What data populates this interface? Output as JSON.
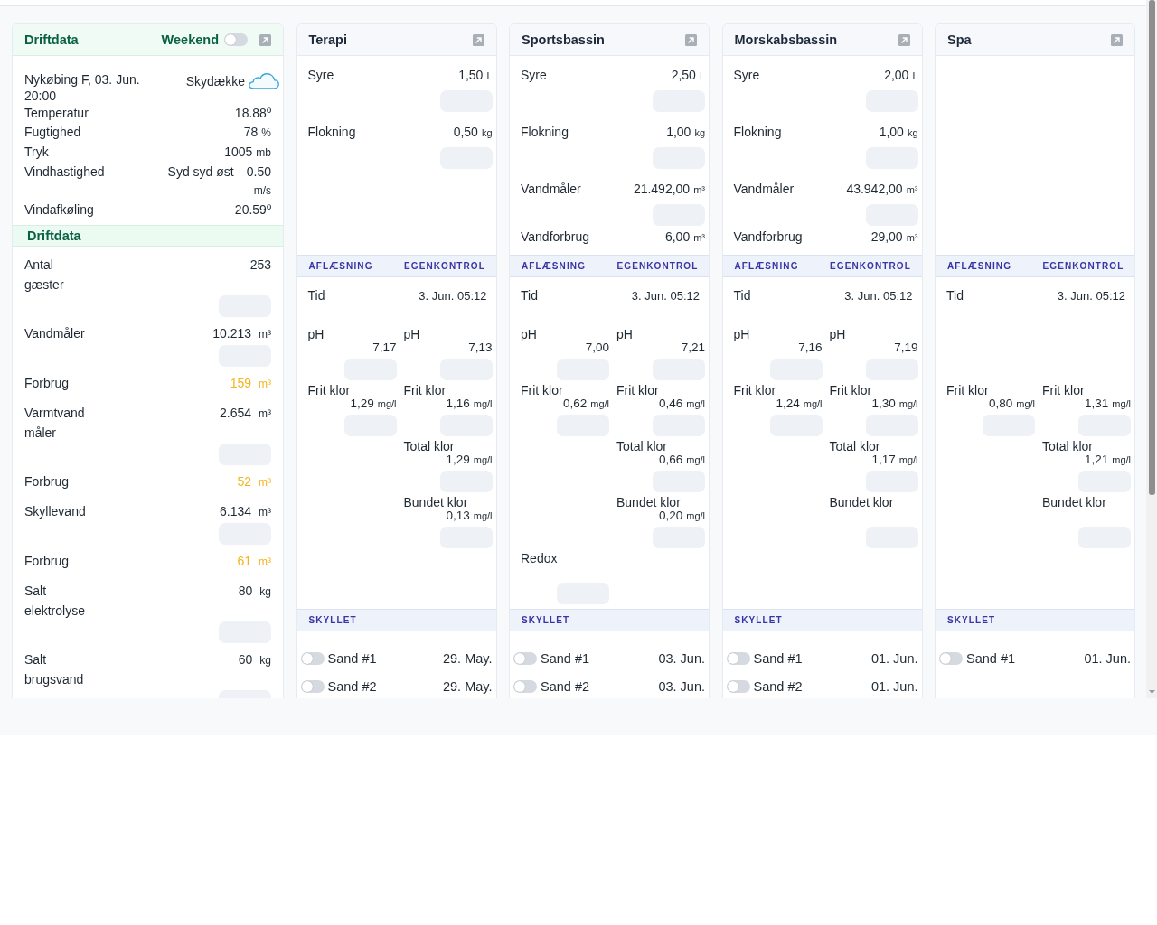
{
  "overview": {
    "title": "Driftdata",
    "weekend": {
      "label": "Weekend",
      "on": false
    },
    "weather": {
      "location": "Nykøbing F, 03. Jun. 20:00",
      "condition": "Skydække",
      "rows": [
        {
          "label": "Temperatur",
          "value": "18.88º"
        },
        {
          "label": "Fugtighed",
          "value": "78",
          "unit": "%"
        },
        {
          "label": "Tryk",
          "value": "1005",
          "unit": "mb"
        },
        {
          "label": "Vindhastighed",
          "direction": "Syd syd øst",
          "value": "0.50",
          "unit": "m/s"
        },
        {
          "label": "Vindafkøling",
          "value": "20.59º"
        }
      ]
    },
    "section_title": "Driftdata",
    "rows": [
      {
        "kind": "meter",
        "label": "Antal gæster",
        "value": "253"
      },
      {
        "kind": "meter",
        "label": "Vandmåler",
        "value": "10.213",
        "unit": "m³"
      },
      {
        "kind": "consumption",
        "label": "Forbrug",
        "value": "159",
        "unit": "m³"
      },
      {
        "kind": "meter",
        "label": "Varmtvand måler",
        "value": "2.654",
        "unit": "m³"
      },
      {
        "kind": "consumption",
        "label": "Forbrug",
        "value": "52",
        "unit": "m³"
      },
      {
        "kind": "meter",
        "label": "Skyllevand",
        "value": "6.134",
        "unit": "m³"
      },
      {
        "kind": "consumption",
        "label": "Forbrug",
        "value": "61",
        "unit": "m³"
      },
      {
        "kind": "meter",
        "label": "Salt elektrolyse",
        "value": "80",
        "unit": "kg"
      },
      {
        "kind": "meter",
        "label": "Salt brugsvand",
        "value": "60",
        "unit": "kg"
      }
    ]
  },
  "pools": [
    {
      "title": "Terapi",
      "supplies": [
        {
          "kind": "meter",
          "label": "Syre",
          "value": "1,50",
          "unit": "L"
        },
        {
          "kind": "meter",
          "label": "Flokning",
          "value": "0,50",
          "unit": "kg"
        }
      ],
      "check_headings": [
        "AFLÆSNING",
        "EGENKONTROL"
      ],
      "time": {
        "label": "Tid",
        "value": "3. Jun. 05:12"
      },
      "measurements": [
        {
          "kind": "values",
          "reading": {
            "label": "pH",
            "value": "7,17"
          },
          "control": {
            "label": "pH",
            "value": "7,13"
          }
        },
        {
          "kind": "values",
          "reading": {
            "label": "Frit klor",
            "value": "1,29",
            "unit": "mg/l"
          },
          "control": {
            "label": "Frit klor",
            "value": "1,16",
            "unit": "mg/l"
          }
        },
        {
          "kind": "values",
          "control": {
            "label": "Total klor",
            "value": "1,29",
            "unit": "mg/l"
          }
        },
        {
          "kind": "values",
          "control": {
            "label": "Bundet klor",
            "value": "0,13",
            "unit": "mg/l"
          }
        }
      ],
      "flush_heading": "SKYLLET",
      "filters": [
        {
          "label": "Sand #1",
          "on": false,
          "date": "29. May."
        },
        {
          "label": "Sand #2",
          "on": false,
          "date": "29. May."
        }
      ]
    },
    {
      "title": "Sportsbassin",
      "supplies": [
        {
          "kind": "meter",
          "label": "Syre",
          "value": "2,50",
          "unit": "L"
        },
        {
          "kind": "meter",
          "label": "Flokning",
          "value": "1,00",
          "unit": "kg"
        },
        {
          "kind": "meter",
          "label": "Vandmåler",
          "value": "21.492,00",
          "unit": "m³"
        },
        {
          "kind": "total",
          "label": "Vandforbrug",
          "value": "6,00",
          "unit": "m³"
        }
      ],
      "check_headings": [
        "AFLÆSNING",
        "EGENKONTROL"
      ],
      "time": {
        "label": "Tid",
        "value": "3. Jun. 05:12"
      },
      "measurements": [
        {
          "kind": "values",
          "reading": {
            "label": "pH",
            "value": "7,00"
          },
          "control": {
            "label": "pH",
            "value": "7,21"
          }
        },
        {
          "kind": "values",
          "reading": {
            "label": "Frit klor",
            "value": "0,62",
            "unit": "mg/l"
          },
          "control": {
            "label": "Frit klor",
            "value": "0,46",
            "unit": "mg/l"
          }
        },
        {
          "kind": "values",
          "control": {
            "label": "Total klor",
            "value": "0,66",
            "unit": "mg/l"
          }
        },
        {
          "kind": "values",
          "control": {
            "label": "Bundet klor",
            "value": "0,20",
            "unit": "mg/l"
          }
        },
        {
          "kind": "values",
          "reading": {
            "label": "Redox"
          }
        }
      ],
      "flush_heading": "SKYLLET",
      "filters": [
        {
          "label": "Sand #1",
          "on": false,
          "date": "03. Jun."
        },
        {
          "label": "Sand #2",
          "on": false,
          "date": "03. Jun."
        }
      ]
    },
    {
      "title": "Morskabsbassin",
      "supplies": [
        {
          "kind": "meter",
          "label": "Syre",
          "value": "2,00",
          "unit": "L"
        },
        {
          "kind": "meter",
          "label": "Flokning",
          "value": "1,00",
          "unit": "kg"
        },
        {
          "kind": "meter",
          "label": "Vandmåler",
          "value": "43.942,00",
          "unit": "m³"
        },
        {
          "kind": "total",
          "label": "Vandforbrug",
          "value": "29,00",
          "unit": "m³"
        }
      ],
      "check_headings": [
        "AFLÆSNING",
        "EGENKONTROL"
      ],
      "time": {
        "label": "Tid",
        "value": "3. Jun. 05:12"
      },
      "measurements": [
        {
          "kind": "values",
          "reading": {
            "label": "pH",
            "value": "7,16"
          },
          "control": {
            "label": "pH",
            "value": "7,19"
          }
        },
        {
          "kind": "values",
          "reading": {
            "label": "Frit klor",
            "value": "1,24",
            "unit": "mg/l"
          },
          "control": {
            "label": "Frit klor",
            "value": "1,30",
            "unit": "mg/l"
          }
        },
        {
          "kind": "values",
          "control": {
            "label": "Total klor",
            "value": "1,17",
            "unit": "mg/l"
          }
        },
        {
          "kind": "values",
          "control": {
            "label": "Bundet klor"
          }
        }
      ],
      "flush_heading": "SKYLLET",
      "filters": [
        {
          "label": "Sand #1",
          "on": false,
          "date": "01. Jun."
        },
        {
          "label": "Sand #2",
          "on": false,
          "date": "01. Jun."
        }
      ]
    },
    {
      "title": "Spa",
      "check_headings": [
        "AFLÆSNING",
        "EGENKONTROL"
      ],
      "time": {
        "label": "Tid",
        "value": "3. Jun. 05:12"
      },
      "measurements": [
        {
          "kind": "blank"
        },
        {
          "kind": "values",
          "reading": {
            "label": "Frit klor",
            "value": "0,80",
            "unit": "mg/l"
          },
          "control": {
            "label": "Frit klor",
            "value": "1,31",
            "unit": "mg/l"
          }
        },
        {
          "kind": "values",
          "control": {
            "label": "Total klor",
            "value": "1,21",
            "unit": "mg/l"
          }
        },
        {
          "kind": "values",
          "control": {
            "label": "Bundet klor"
          }
        }
      ],
      "flush_heading": "SKYLLET",
      "filters": [
        {
          "label": "Sand #1",
          "on": false,
          "date": "01. Jun."
        }
      ]
    }
  ]
}
